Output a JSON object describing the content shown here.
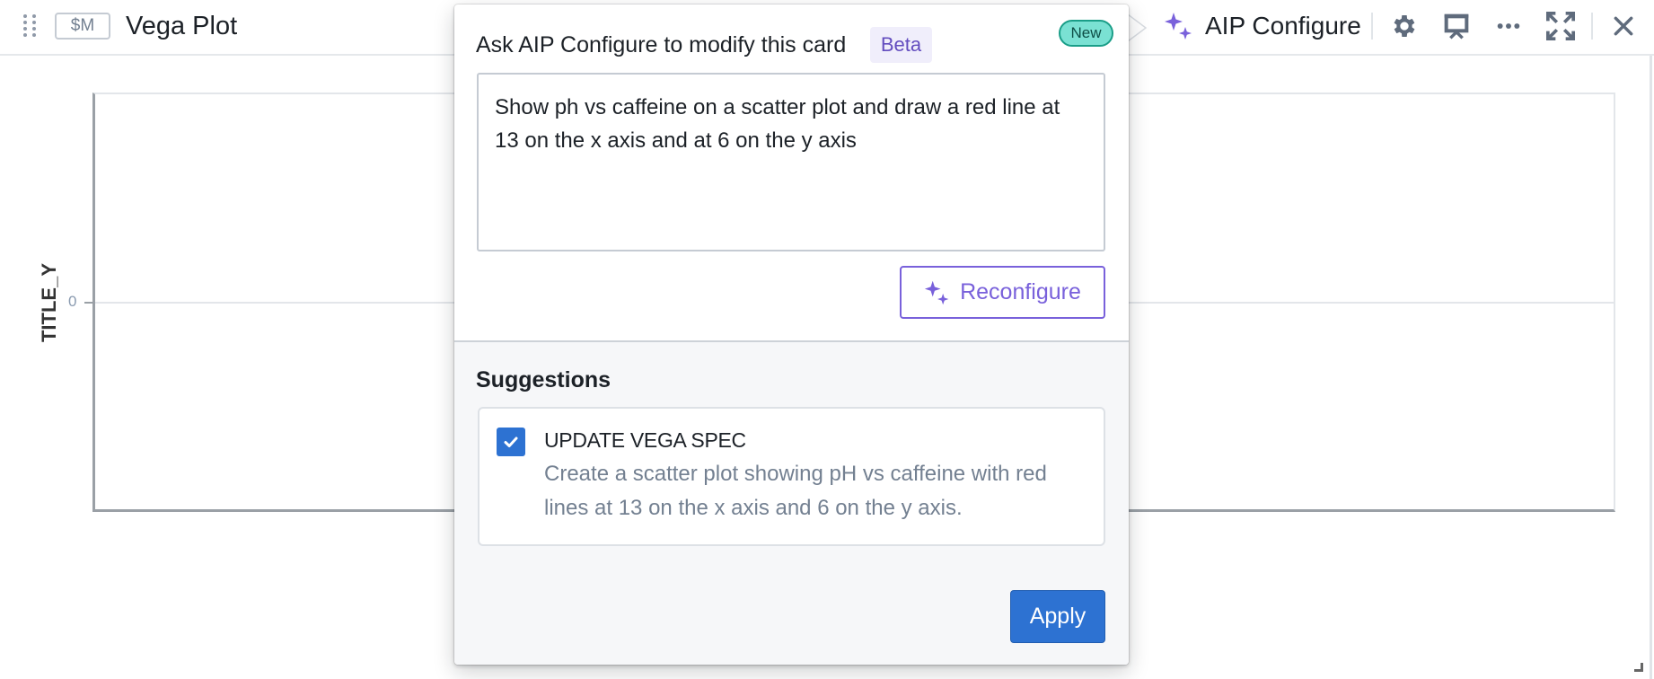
{
  "header": {
    "badge": "$M",
    "title": "Vega Plot",
    "aip_button_label": "AIP Configure",
    "icons": [
      "drag-handle-icon",
      "sparkles-icon",
      "gear-icon",
      "presentation-icon",
      "more-icon",
      "maximize-icon",
      "close-icon"
    ]
  },
  "plot": {
    "y_title": "TITLE_Y",
    "y_tick_labels": [
      "0"
    ]
  },
  "popover": {
    "title": "Ask AIP Configure to modify this card",
    "beta_label": "Beta",
    "new_label": "New",
    "prompt_value": "Show ph vs caffeine on a scatter plot and draw a red line at 13 on the x axis and at 6 on the y axis",
    "reconfigure_label": "Reconfigure",
    "suggestions_title": "Suggestions",
    "suggestions": [
      {
        "checked": true,
        "name": "UPDATE VEGA SPEC",
        "description": "Create a scatter plot showing pH vs caffeine with red lines at 13 on the x axis and 6 on the y axis."
      }
    ],
    "apply_label": "Apply"
  },
  "colors": {
    "accent_purple": "#7961db",
    "primary_blue": "#2d72d2",
    "new_badge_bg": "#7ae1d3",
    "beta_text": "#634dbf"
  }
}
